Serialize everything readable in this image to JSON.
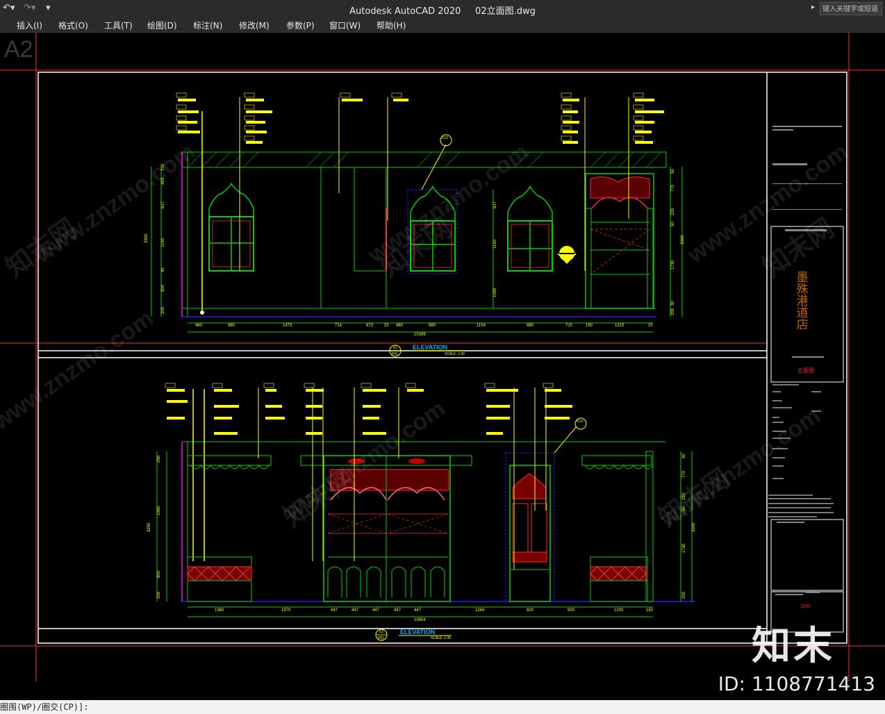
{
  "window": {
    "app_title": "Autodesk AutoCAD 2020",
    "file_name": "02立面图.dwg",
    "search_placeholder": "键入关键字或短语"
  },
  "menus": [
    "插入(I)",
    "格式(O)",
    "工具(T)",
    "绘图(D)",
    "标注(N)",
    "修改(M)",
    "参数(P)",
    "窗口(W)",
    "帮助(H)"
  ],
  "viewport": {
    "sheet_label": "A2",
    "upper_elevation": {
      "tag_top": "E1",
      "tag_bottom": "P01",
      "title": "ELEVATION",
      "scale": "SCALE: 1:30",
      "total_dimension": "10169",
      "bottom_dimensions": [
        "460",
        "980",
        "1473",
        "714",
        "673",
        "20",
        "460",
        "980",
        "1154",
        "980",
        "710",
        "150",
        "1215",
        "20"
      ],
      "left_dimensions": [
        "100",
        "443",
        "617",
        "1190",
        "40",
        "800",
        "200"
      ],
      "left_total": "3300",
      "mid_dimensions": [
        "617",
        "1190",
        "1000"
      ],
      "right_dimensions": [
        "50",
        "770",
        "220",
        "50",
        "1730",
        "30",
        "200"
      ],
      "right_total": "3300",
      "callout_tags": [
        "D12"
      ]
    },
    "lower_elevation": {
      "tag_top": "E2",
      "tag_bottom": "P01",
      "title": "ELEVATION",
      "scale": "SCALE: 1:30",
      "total_dimension": "10654",
      "bottom_dimensions": [
        "1360",
        "1970",
        "447",
        "447",
        "447",
        "447",
        "447",
        "1284",
        "820",
        "900",
        "1200",
        "150"
      ],
      "left_dimensions": [
        "250",
        "1950",
        "800",
        "200"
      ],
      "left_total": "3250",
      "right_dimensions": [
        "50",
        "770",
        "220",
        "50",
        "1730",
        "200"
      ],
      "right_total": "3300",
      "callout_tags": [
        "D13"
      ]
    },
    "title_block": {
      "vertical_title": "墨殊港道店",
      "red_label": "立面图",
      "bottom_red": "D06"
    }
  },
  "watermark": {
    "brand": "知末",
    "id_text": "ID: 1108771413",
    "site": "www.znzmo.com",
    "site_cn": "知末网"
  },
  "command_line": {
    "text": "圈围(WP)/圈交(CP)]:"
  },
  "colors": {
    "cad_background": "#000000",
    "cad_red": "#ff2a2a",
    "cad_green": "#00d200",
    "cad_yellow": "#ffff00",
    "cad_magenta": "#ff00ff",
    "cad_blue": "#2020ff",
    "ui_dark": "#2b2b2b"
  }
}
